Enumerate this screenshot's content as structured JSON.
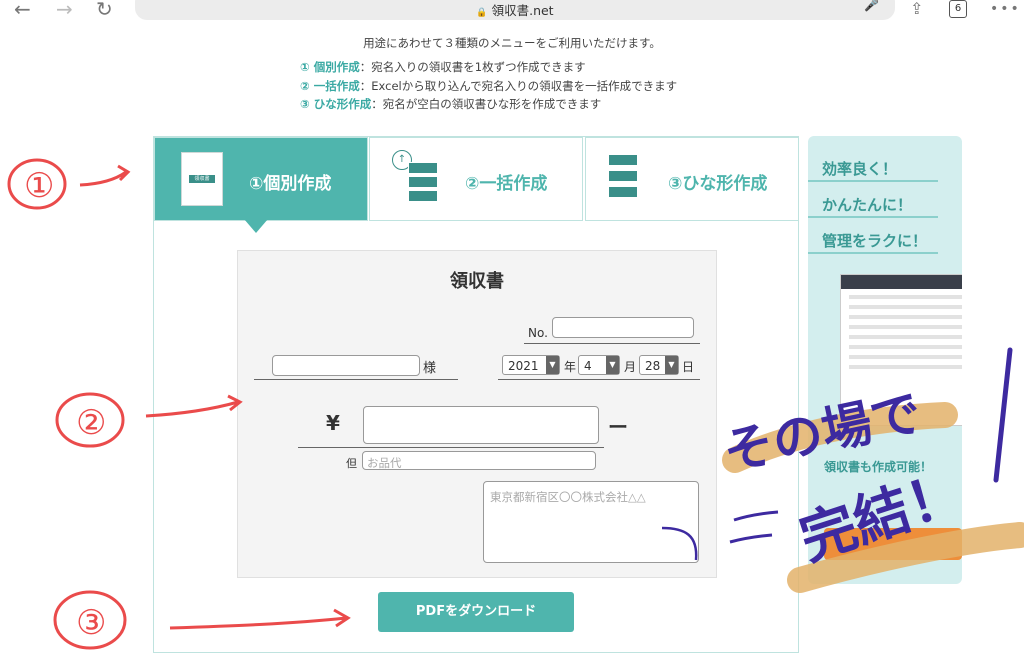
{
  "browser": {
    "url": "領収書.net",
    "tab_count": "6"
  },
  "intro": {
    "heading": "用途にあわせて３種類のメニューをご利用いただけます。",
    "menus": [
      {
        "tag": "① 個別作成",
        "desc": "：宛名入りの領収書を1枚ずつ作成できます"
      },
      {
        "tag": "② 一括作成",
        "desc": "：Excelから取り込んで宛名入りの領収書を一括作成できます"
      },
      {
        "tag": "③ ひな形作成",
        "desc": "：宛名が空白の領収書ひな形を作成できます"
      }
    ]
  },
  "tabs": {
    "individual": "①個別作成",
    "bulk": "②一括作成",
    "template": "③ひな形作成",
    "icon_text": "領収書"
  },
  "receipt": {
    "title": "領収書",
    "no_label": "No.",
    "sama_label": "様",
    "year_value": "2021",
    "year_label": "年",
    "month_value": "4",
    "month_label": "月",
    "day_value": "28",
    "day_label": "日",
    "yen_label": "¥",
    "dash_label": "ー",
    "tadashi_label": "但",
    "tadashi_placeholder": "お品代",
    "issuer_placeholder": "東京都新宿区〇〇株式会社△△"
  },
  "download_button": "PDFをダウンロード",
  "banner": {
    "lines": [
      "効率良く！",
      "かんたんに！",
      "管理をラクに！"
    ],
    "sub": "領収書も作成可能！"
  },
  "annotations": {
    "marks": [
      "①",
      "②",
      "③"
    ],
    "handwritten_left": "その場で",
    "handwritten_right": "完結！"
  },
  "colors": {
    "accent": "#4fb5ad",
    "annotation_red": "#ea4b4b",
    "annotation_purple": "#3d2aa0",
    "highlighter": "#e3b26a"
  }
}
